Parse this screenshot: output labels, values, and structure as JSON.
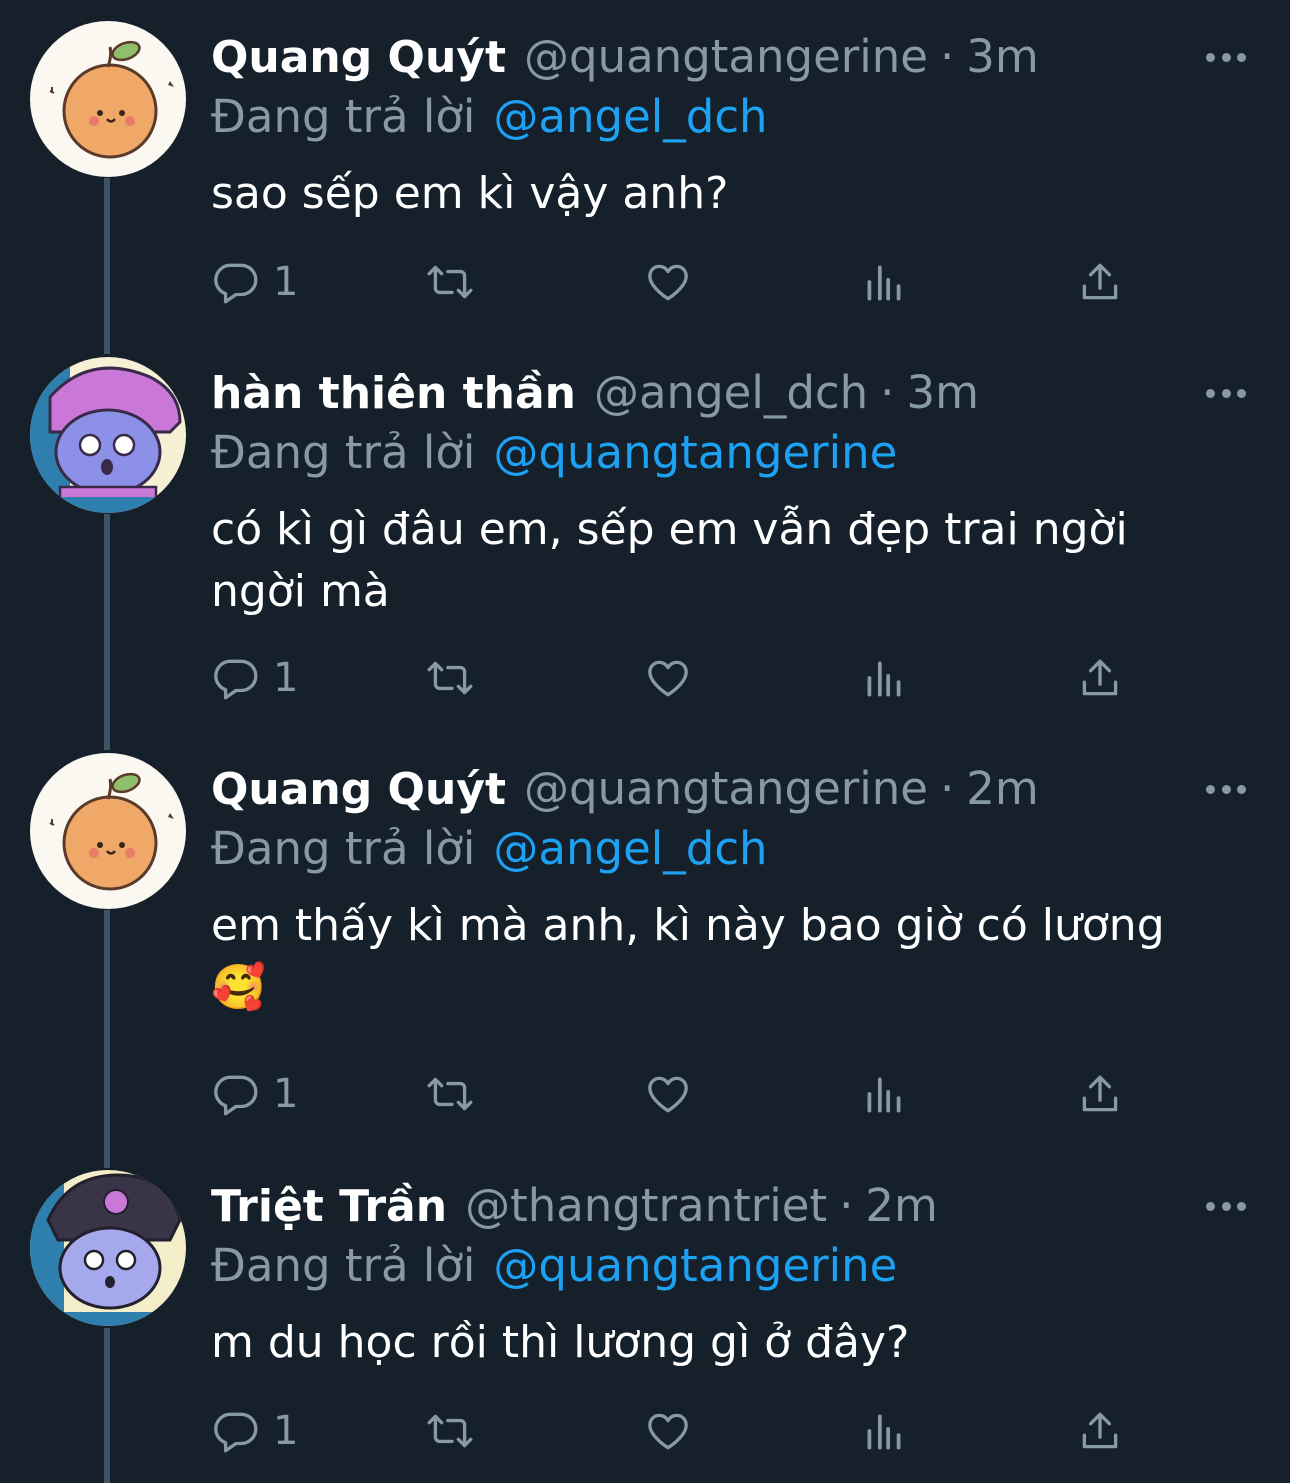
{
  "tweets": [
    {
      "name": "Quang Quýt",
      "handle": "@quangtangerine",
      "separator": "·",
      "time": "3m",
      "replying_prefix": "Đang trả lời",
      "replying_to": "@angel_dch",
      "text_lines": [
        "sao sếp em kì vậy anh?"
      ],
      "reply_count": "1",
      "avatar": "orange-avatar"
    },
    {
      "name": "hàn thiên thần",
      "handle": "@angel_dch",
      "separator": "·",
      "time": "3m",
      "replying_prefix": "Đang trả lời",
      "replying_to": "@quangtangerine",
      "text_lines": [
        "có kì gì đâu em, sếp em vẫn đẹp trai ngời",
        "ngời mà"
      ],
      "reply_count": "1",
      "avatar": "purple-bunny-avatar"
    },
    {
      "name": "Quang Quýt",
      "handle": "@quangtangerine",
      "separator": "·",
      "time": "2m",
      "replying_prefix": "Đang trả lời",
      "replying_to": "@angel_dch",
      "text_lines": [
        "em thấy kì mà anh, kì này bao giờ có lương",
        "🥰"
      ],
      "reply_count": "1",
      "avatar": "orange-avatar"
    },
    {
      "name": "Triệt Trần",
      "handle": "@thangtrantriet",
      "separator": "·",
      "time": "2m",
      "replying_prefix": "Đang trả lời",
      "replying_to": "@quangtangerine",
      "text_lines": [
        "m du học rồi thì lương gì ở đây?"
      ],
      "reply_count": "1",
      "avatar": "kuromi-avatar"
    }
  ],
  "icons": {
    "reply": "reply-icon",
    "retweet": "retweet-icon",
    "like": "heart-icon",
    "views": "analytics-icon",
    "share": "share-icon",
    "more": "more-dots-icon"
  },
  "colors": {
    "background": "#15202b",
    "text": "#ffffff",
    "muted": "#8899a6",
    "link": "#1da1f2",
    "thread_line": "#3d5466"
  }
}
